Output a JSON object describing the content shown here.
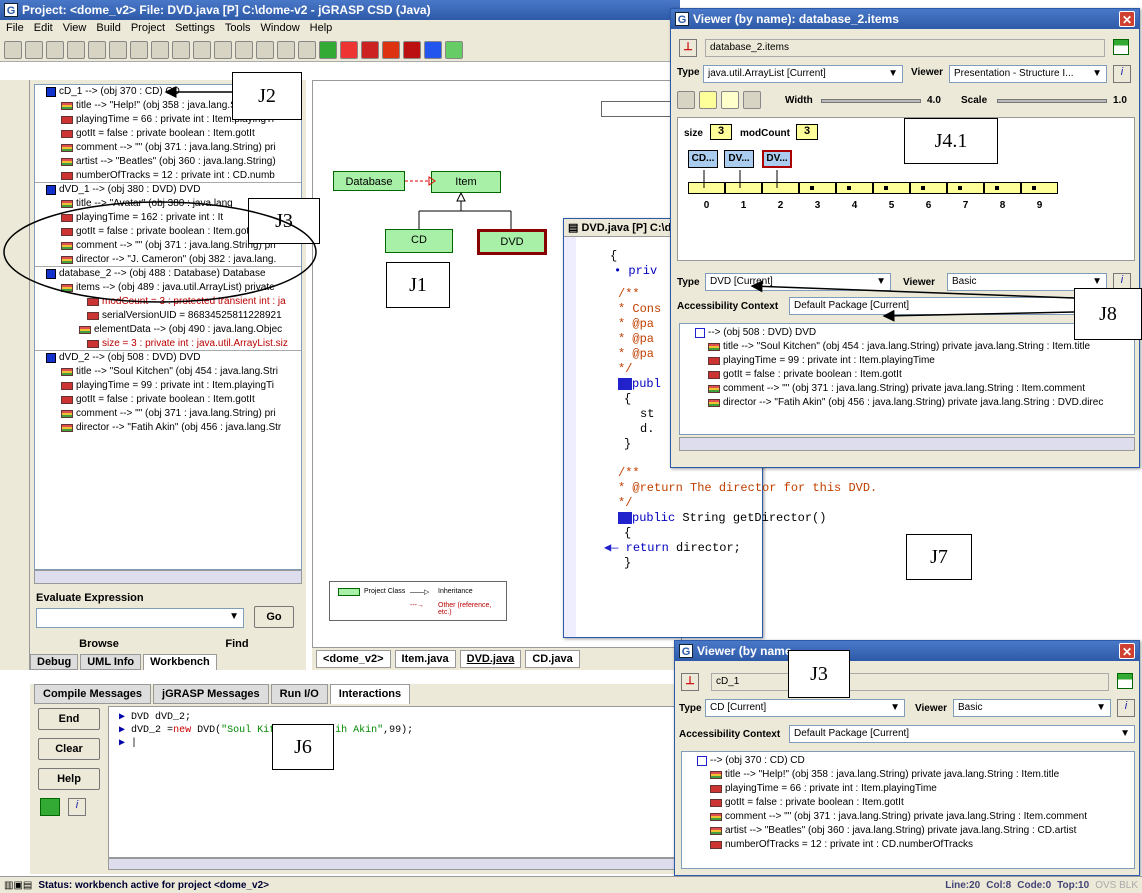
{
  "main_window": {
    "title": "Project: <dome_v2>    File: DVD.java [P]  C:\\dome-v2 - jGRASP CSD (Java)",
    "menu": [
      "File",
      "Edit",
      "View",
      "Build",
      "Project",
      "Settings",
      "Tools",
      "Window",
      "Help"
    ]
  },
  "workbench_tree": {
    "cd1": {
      "header": "cD_1 --> (obj 370 : CD)  CD",
      "fields": [
        "title --> \"Help!\" (obj 358 : java.lang.String)",
        "playingTime = 66  :  private int : Item.playingTi",
        "gotIt = false  :  private boolean : Item.gotIt",
        "comment --> \"\" (obj 371 : java.lang.String)  pri",
        "artist --> \"Beatles\" (obj 360 : java.lang.String)",
        "numberOfTracks = 12  :  private int : CD.numb"
      ]
    },
    "dvd1": {
      "header": "dVD_1 --> (obj 380 : DVD)  DVD",
      "fields": [
        "title --> \"Avatar\" (obj 380 : java.lang",
        "playingTime = 162  :  private int : It",
        "gotIt = false  :  private boolean : Item.gotIt",
        "comment --> \"\" (obj 371 : java.lang.String)  pri",
        "director --> \"J. Cameron\" (obj 382 : java.lang."
      ]
    },
    "db2": {
      "header": "database_2 --> (obj 488 : Database)  Database",
      "items": "items --> (obj 489 : java.util.ArrayList)  private",
      "fields": [
        "modCount = 3  :  protected transient int : ja",
        "serialVersionUID = 86834525811228921",
        "elementData --> (obj 490 : java.lang.Objec",
        "size = 3  :  private int : java.util.ArrayList.siz"
      ]
    },
    "dvd2": {
      "header": "dVD_2 --> (obj 508 : DVD)  DVD",
      "fields": [
        "title --> \"Soul Kitchen\" (obj 454 : java.lang.Stri",
        "playingTime = 99  :  private int : Item.playingTi",
        "gotIt = false  :  private boolean : Item.gotIt",
        "comment --> \"\" (obj 371 : java.lang.String)  pri",
        "director --> \"Fatih Akin\" (obj 456 : java.lang.Str"
      ]
    }
  },
  "evaluate": {
    "label": "Evaluate Expression",
    "go": "Go"
  },
  "left_tabs": {
    "browse": "Browse",
    "find": "Find",
    "debug": "Debug",
    "uml": "UML Info",
    "workbench": "Workbench"
  },
  "uml": {
    "database": "Database",
    "item": "Item",
    "cd": "CD",
    "dvd": "DVD",
    "legend": {
      "project_class": "Project Class",
      "inheritance": "Inheritance",
      "other": "Other (reference, etc.)"
    }
  },
  "file_tabs": [
    "<dome_v2>",
    "Item.java",
    "DVD.java",
    "CD.java"
  ],
  "bottom_tabs": [
    "Compile Messages",
    "jGRASP Messages",
    "Run I/O",
    "Interactions"
  ],
  "bottom_buttons": {
    "end": "End",
    "clear": "Clear",
    "help": "Help"
  },
  "interactions": {
    "line1": "DVD dVD_2;",
    "line2_a": "dVD_2 =",
    "line2_new": "new",
    "line2_b": " DVD(",
    "line2_str": "\"Soul Kitchen\",\"Fatih Akin\"",
    "line2_c": ",99);"
  },
  "editor": {
    "title": "DVD.java [P]  C:\\d",
    "lines": {
      "brace": "{",
      "priv": "priv",
      "c1": "/**",
      "c2": " * Cons",
      "c3": " * @pa",
      "c4": " * @pa",
      "c5": " * @pa",
      "c6": " */",
      "publ": "publ",
      "st": "st",
      "d": "d.",
      "c7": "/**",
      "c8": " * @return The director for this DVD.",
      "c9": " */",
      "sig_kw": "public",
      "sig": " String getDirector()",
      "ret_kw": "return",
      "ret": " director;"
    }
  },
  "viewer1": {
    "title": "Viewer (by name): database_2.items",
    "name": "database_2.items",
    "type_label": "Type",
    "type_value": "java.util.ArrayList [Current]",
    "viewer_label": "Viewer",
    "viewer_value": "Presentation - Structure I...",
    "width_label": "Width",
    "width_value": "4.0",
    "scale_label": "Scale",
    "scale_value": "1.0",
    "size_label": "size",
    "size_value": "3",
    "mod_label": "modCount",
    "mod_value": "3",
    "boxes": [
      "CD...",
      "DV...",
      "DV..."
    ],
    "indices": [
      "0",
      "1",
      "2",
      "3",
      "4",
      "5",
      "6",
      "7",
      "8",
      "9"
    ],
    "type2_label": "Type",
    "type2_value": "DVD [Current]",
    "viewer2_label": "Viewer",
    "viewer2_value": "Basic",
    "access_label": "Accessibility Context",
    "access_value": "Default Package [Current]",
    "tree_header": "--> (obj 508 : DVD)  DVD",
    "tree": [
      "title --> \"Soul Kitchen\" (obj 454 : java.lang.String)  private java.lang.String : Item.title",
      "playingTime = 99  :  private int : Item.playingTime",
      "gotIt = false  :  private boolean : Item.gotIt",
      "comment --> \"\" (obj 371 : java.lang.String)  private java.lang.String : Item.comment",
      "director --> \"Fatih Akin\" (obj 456 : java.lang.String)  private java.lang.String : DVD.direc"
    ]
  },
  "viewer2": {
    "title": "Viewer (by name",
    "name": "cD_1",
    "type_label": "Type",
    "type_value": "CD [Current]",
    "viewer_label": "Viewer",
    "viewer_value": "Basic",
    "access_label": "Accessibility Context",
    "access_value": "Default Package [Current]",
    "tree_header": "--> (obj 370 : CD)  CD",
    "tree": [
      "title --> \"Help!\" (obj 358 : java.lang.String)  private java.lang.String : Item.title",
      "playingTime = 66  :  private int : Item.playingTime",
      "gotIt = false  :  private boolean : Item.gotIt",
      "comment --> \"\" (obj 371 : java.lang.String)  private java.lang.String : Item.comment",
      "artist --> \"Beatles\" (obj 360 : java.lang.String)  private java.lang.String : CD.artist",
      "numberOfTracks = 12  :  private int : CD.numberOfTracks"
    ]
  },
  "status": {
    "text": "Status: workbench active for project <dome_v2>",
    "line": "Line:20",
    "col": "Col:8",
    "code": "Code:0",
    "top": "Top:10",
    "ovs": "OVS BLK"
  },
  "callouts": {
    "j1": "J1",
    "j2": "J2",
    "j3": "J3",
    "j3b": "J3",
    "j41": "J4.1",
    "j6": "J6",
    "j7": "J7",
    "j8": "J8"
  }
}
